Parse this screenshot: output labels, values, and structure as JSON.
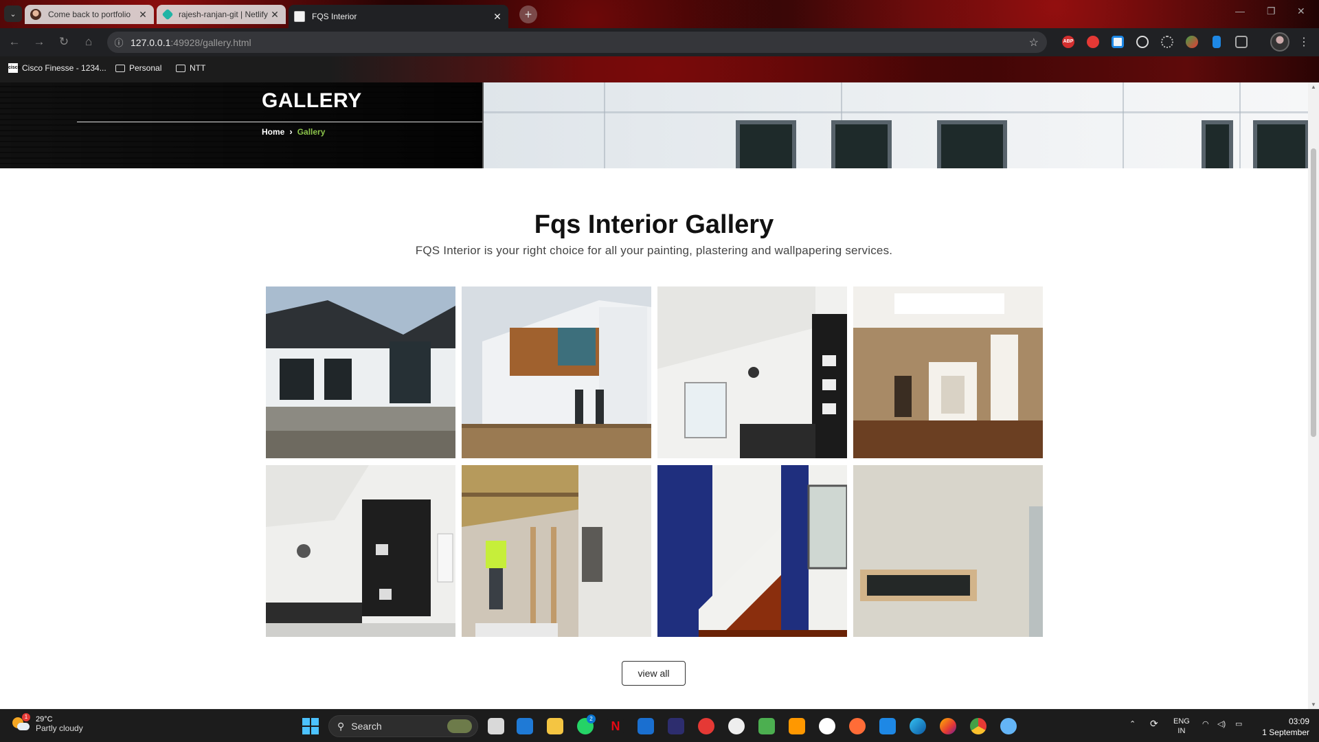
{
  "browser": {
    "tabs": [
      {
        "title": "Come back to portfolio",
        "active": false
      },
      {
        "title": "rajesh-ranjan-git | Netlify",
        "active": false
      },
      {
        "title": "FQS Interior",
        "active": true
      }
    ],
    "address": {
      "host": "127.0.0.1",
      "path": ":49928/gallery.html"
    },
    "bookmarks": [
      "Cisco Finesse - 1234...",
      "Personal",
      "NTT"
    ],
    "extensions": [
      "abp-icon",
      "pdf-icon",
      "s-icon",
      "target-icon",
      "react-icon",
      "earth-icon",
      "doc-icon",
      "puzzle-icon"
    ],
    "extension_labels": {
      "abp": "ABP"
    },
    "cisco_favicon_text": "cisco"
  },
  "hero": {
    "title": "GALLERY",
    "breadcrumb": {
      "home": "Home",
      "current": "Gallery"
    }
  },
  "gallery": {
    "title": "Fqs Interior Gallery",
    "subtitle": "FQS Interior is your right choice for all your painting, plastering and wallpapering services.",
    "images": [
      {
        "name": "house-exterior-gable"
      },
      {
        "name": "house-exterior-cedar"
      },
      {
        "name": "living-room-ceiling-fan"
      },
      {
        "name": "living-room-fireplace"
      },
      {
        "name": "kitchen-dark-cabinets"
      },
      {
        "name": "ceiling-insulation-work"
      },
      {
        "name": "staircase-blue-wall"
      },
      {
        "name": "plastered-wall-window"
      }
    ],
    "view_all": "view all"
  },
  "taskbar": {
    "weather": {
      "temp": "29°C",
      "condition": "Partly cloudy",
      "badge": "1"
    },
    "search_label": "Search",
    "whatsapp_badge": "2",
    "lang": {
      "line1": "ENG",
      "line2": "IN"
    },
    "clock": {
      "time": "03:09",
      "date": "1 September"
    }
  }
}
